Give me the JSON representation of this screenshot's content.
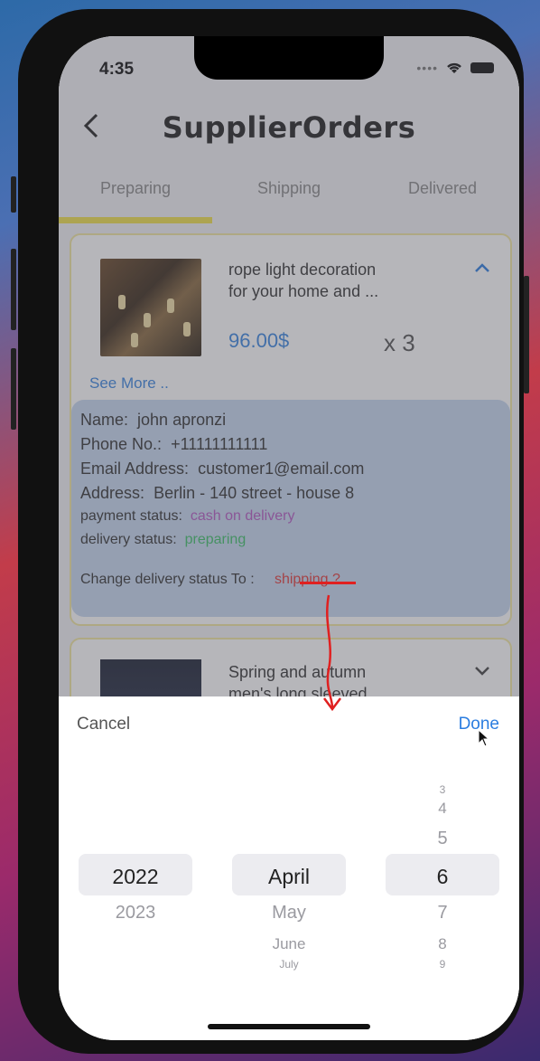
{
  "status_bar": {
    "time": "4:35"
  },
  "header": {
    "title": "SupplierOrders"
  },
  "tabs": [
    {
      "label": "Preparing"
    },
    {
      "label": "Shipping"
    },
    {
      "label": "Delivered"
    }
  ],
  "orders": [
    {
      "name_line1": "rope light decoration",
      "name_line2": "for your home and ...",
      "price": "96.00$",
      "qty": "x 3",
      "see_more": "See More ..",
      "details": {
        "name_label": "Name:",
        "name_value": "john apronzi",
        "phone_label": "Phone No.:",
        "phone_value": "+11111111111",
        "email_label": "Email Address:",
        "email_value": "customer1@email.com",
        "address_label": "Address:",
        "address_value": "Berlin - 140 street - house 8",
        "payment_label": "payment status:",
        "payment_value": "cash on delivery",
        "delivery_label": "delivery status:",
        "delivery_value": "preparing",
        "change_label": "Change delivery status To :",
        "change_link": "shipping ?"
      }
    },
    {
      "name_line1": "Spring and autumn",
      "name_line2": "men's long sleeved ..."
    }
  ],
  "picker": {
    "cancel": "Cancel",
    "done": "Done",
    "years": {
      "selected": "2022",
      "after": [
        "2023"
      ]
    },
    "months": {
      "selected": "April",
      "after": [
        "May",
        "June",
        "July"
      ]
    },
    "days": {
      "before": [
        "3",
        "4",
        "5"
      ],
      "selected": "6",
      "after": [
        "7",
        "8",
        "9"
      ]
    }
  },
  "colors": {
    "accent": "#2b7de0",
    "tab_indicator": "#f0e04b",
    "annotation": "#e02020"
  }
}
